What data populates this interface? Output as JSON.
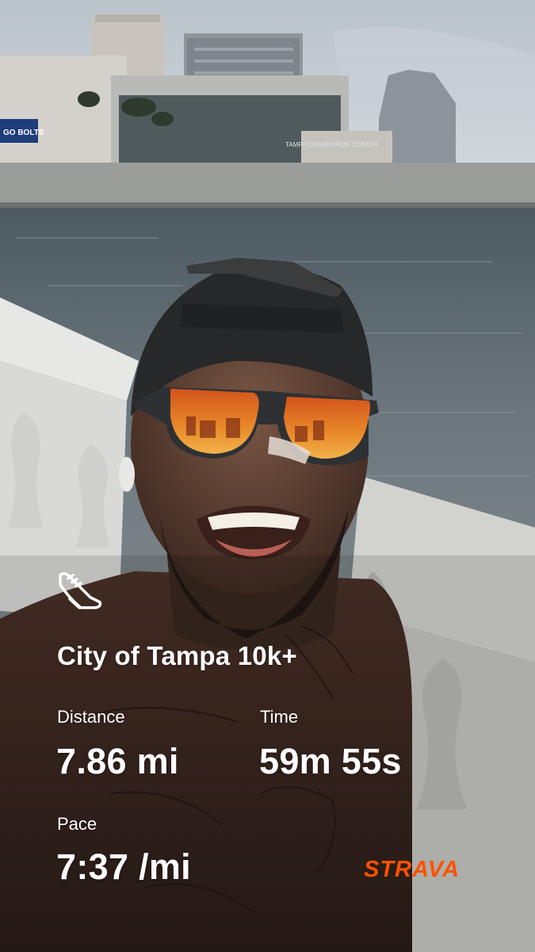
{
  "activity": {
    "title": "City of Tampa 10k+",
    "icon": "running-shoe-icon"
  },
  "stats": {
    "distance": {
      "label": "Distance",
      "value": "7.86 mi"
    },
    "time": {
      "label": "Time",
      "value": "59m 55s"
    },
    "pace": {
      "label": "Pace",
      "value": "7:37 /mi"
    }
  },
  "brand": {
    "name": "STRAVA",
    "color": "#fc5200"
  },
  "photo": {
    "sign_text": "GO BOLTS",
    "building_sign_text": "TAMPA CONVENTION CENTER"
  },
  "colors": {
    "text": "#ffffff",
    "accent": "#fc5200"
  }
}
